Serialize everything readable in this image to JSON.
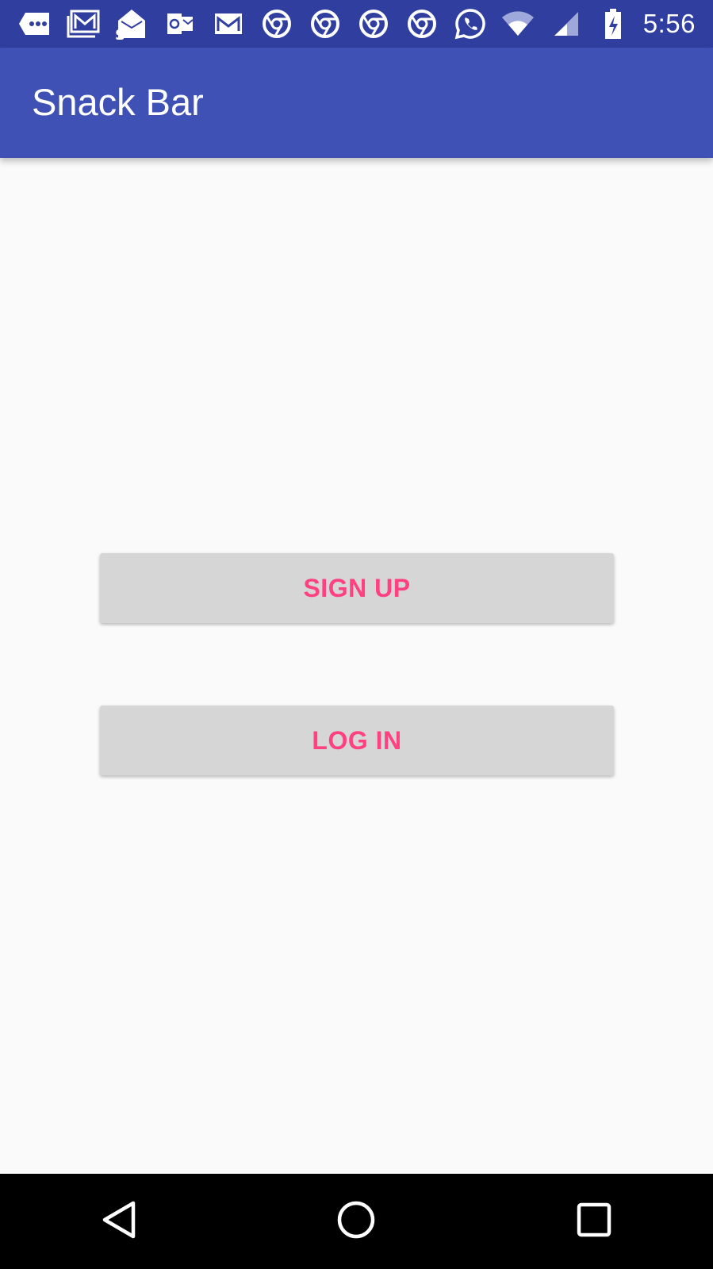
{
  "status_bar": {
    "time": "5:56",
    "notification_icons": [
      "chat-bubble-icon",
      "gmail-icon",
      "sms-mail-icon",
      "outlook-icon",
      "gmail-icon",
      "chrome-icon",
      "chrome-icon",
      "chrome-icon",
      "chrome-icon",
      "whatsapp-icon"
    ],
    "system_icons": [
      "wifi-icon",
      "cell-signal-icon",
      "battery-charging-icon"
    ]
  },
  "app_bar": {
    "title": "Snack Bar"
  },
  "buttons": {
    "signup_label": "SIGN UP",
    "login_label": "LOG IN"
  },
  "nav_bar": {
    "buttons": [
      "back-icon",
      "home-icon",
      "recents-icon"
    ]
  },
  "colors": {
    "status_bar": "#303f9f",
    "primary": "#3f51b5",
    "accent": "#ff4081",
    "button_bg": "#d6d6d6",
    "background": "#fafafa"
  }
}
